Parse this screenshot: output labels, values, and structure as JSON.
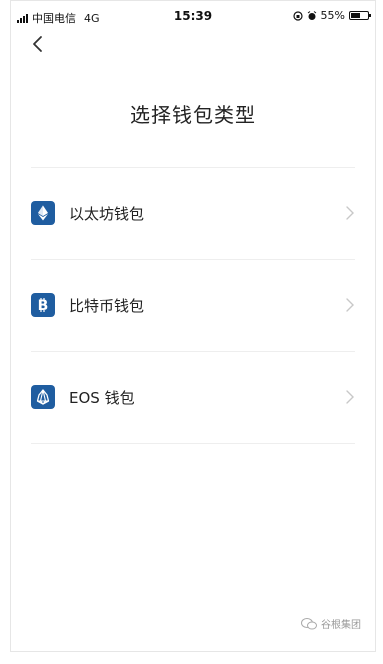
{
  "status_bar": {
    "carrier": "中国电信",
    "network": "4G",
    "time": "15:39",
    "battery_text": "55%",
    "battery_level": 0.55
  },
  "header": {
    "back_icon": "chevron-left-icon",
    "title": "选择钱包类型"
  },
  "wallets": [
    {
      "label": "以太坊钱包",
      "icon": "ethereum-icon",
      "color": "#1f5da0"
    },
    {
      "label": "比特币钱包",
      "icon": "bitcoin-icon",
      "color": "#1f5da0"
    },
    {
      "label": "EOS 钱包",
      "icon": "eos-icon",
      "color": "#1f5da0"
    }
  ],
  "watermark": {
    "text": "谷根集团",
    "icon": "wechat-icon"
  }
}
